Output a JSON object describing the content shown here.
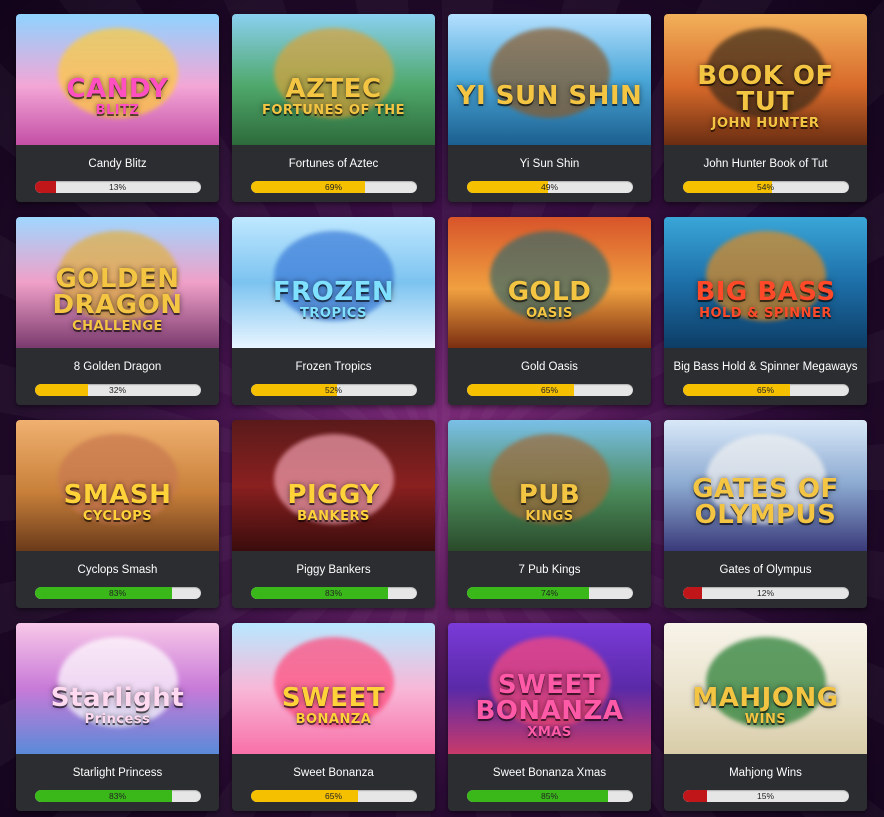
{
  "games": [
    {
      "name": "Candy Blitz",
      "percent": 13,
      "logo": [
        "CANDY",
        "BLITZ"
      ],
      "logo_color": "#ff4fc0",
      "fill_color": "#c0161a"
    },
    {
      "name": "Fortunes of Aztec",
      "percent": 69,
      "logo": [
        "AZTEC",
        "FORTUNES OF THE"
      ],
      "logo_color": "#f4c542",
      "fill_color": "#f5c000"
    },
    {
      "name": "Yi Sun Shin",
      "percent": 49,
      "logo": [
        "YI SUN SHIN",
        ""
      ],
      "logo_color": "#f4c542",
      "fill_color": "#f5c000"
    },
    {
      "name": "John Hunter Book of Tut",
      "percent": 54,
      "logo": [
        "BOOK OF TUT",
        "JOHN HUNTER"
      ],
      "logo_color": "#f4c542",
      "fill_color": "#f5c000"
    },
    {
      "name": "8 Golden Dragon",
      "percent": 32,
      "logo": [
        "GOLDEN DRAGON",
        "CHALLENGE"
      ],
      "logo_color": "#f4c542",
      "fill_color": "#f5c000"
    },
    {
      "name": "Frozen Tropics",
      "percent": 52,
      "logo": [
        "FROZEN",
        "TROPICS"
      ],
      "logo_color": "#7fe0ff",
      "fill_color": "#f5c000"
    },
    {
      "name": "Gold Oasis",
      "percent": 65,
      "logo": [
        "GOLD",
        "OASIS"
      ],
      "logo_color": "#f4c542",
      "fill_color": "#f5c000"
    },
    {
      "name": "Big Bass Hold & Spinner Megaways",
      "percent": 65,
      "logo": [
        "BIG BASS",
        "HOLD & SPINNER"
      ],
      "logo_color": "#ff4a2a",
      "fill_color": "#f5c000"
    },
    {
      "name": "Cyclops Smash",
      "percent": 83,
      "logo": [
        "SMASH",
        "CYCLOPS"
      ],
      "logo_color": "#ffd23a",
      "fill_color": "#3ab81a"
    },
    {
      "name": "Piggy Bankers",
      "percent": 83,
      "logo": [
        "PIGGY",
        "BANKERS"
      ],
      "logo_color": "#ffd23a",
      "fill_color": "#3ab81a"
    },
    {
      "name": "7 Pub Kings",
      "percent": 74,
      "logo": [
        "PUB",
        "KINGS"
      ],
      "logo_color": "#f4c542",
      "fill_color": "#3ab81a"
    },
    {
      "name": "Gates of Olympus",
      "percent": 12,
      "logo": [
        "GATES OF OLYMPUS",
        ""
      ],
      "logo_color": "#f4c542",
      "fill_color": "#c0161a"
    },
    {
      "name": "Starlight Princess",
      "percent": 83,
      "logo": [
        "Starlight",
        "Princess"
      ],
      "logo_color": "#ffd9f0",
      "fill_color": "#3ab81a"
    },
    {
      "name": "Sweet Bonanza",
      "percent": 65,
      "logo": [
        "SWEET",
        "BONANZA"
      ],
      "logo_color": "#ffd23a",
      "fill_color": "#f5c000"
    },
    {
      "name": "Sweet Bonanza Xmas",
      "percent": 85,
      "logo": [
        "SWEET BONANZA",
        "XMAS"
      ],
      "logo_color": "#ff5aa8",
      "fill_color": "#3ab81a"
    },
    {
      "name": "Mahjong Wins",
      "percent": 15,
      "logo": [
        "MAHJONG",
        "WINS"
      ],
      "logo_color": "#f4c542",
      "fill_color": "#c0161a"
    }
  ]
}
